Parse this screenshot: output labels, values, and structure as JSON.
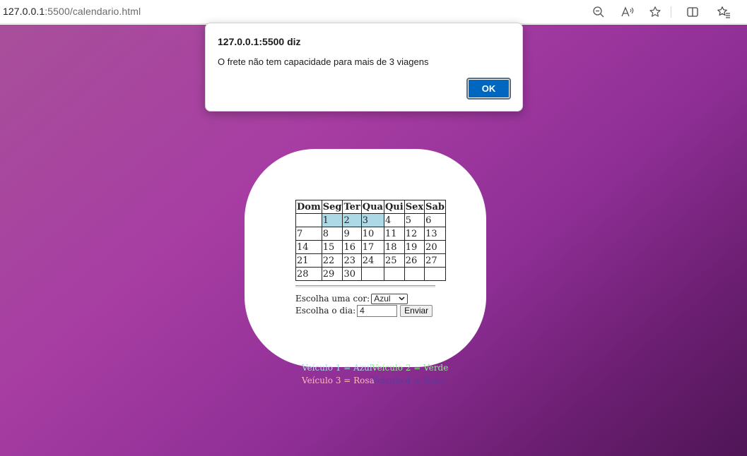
{
  "browser": {
    "url_host": "127.0.0.1",
    "url_rest": ":5500/calendario.html"
  },
  "dialog": {
    "title": "127.0.0.1:5500 diz",
    "message": "O frete não tem capacidade para mais de 3 viagens",
    "ok_label": "OK"
  },
  "calendar": {
    "headers": [
      "Dom",
      "Seg",
      "Ter",
      "Qua",
      "Qui",
      "Sex",
      "Sab"
    ],
    "rows": [
      [
        "",
        "1",
        "2",
        "3",
        "4",
        "5",
        "6"
      ],
      [
        "7",
        "8",
        "9",
        "10",
        "11",
        "12",
        "13"
      ],
      [
        "14",
        "15",
        "16",
        "17",
        "18",
        "19",
        "20"
      ],
      [
        "21",
        "22",
        "23",
        "24",
        "25",
        "26",
        "27"
      ],
      [
        "28",
        "29",
        "30",
        "",
        "",
        "",
        ""
      ]
    ],
    "highlighted_days": [
      "1",
      "2",
      "3"
    ],
    "highlight_color": "#add8e6"
  },
  "form": {
    "color_label": "Escolha uma cor:",
    "color_selected": "Azul",
    "day_label": "Escolha o dia:",
    "day_value": "4",
    "submit_label": "Enviar"
  },
  "legend": {
    "v1": "Veículo 1 = Azul",
    "v2": "Veículo 2 = Verde",
    "v3": "Veículo 3 = Rosa",
    "v4": "Veículo 4 = Roxo"
  },
  "colors": {
    "azul": "#add8e6",
    "verde": "#90ee90",
    "rosa": "#ffb6c1",
    "roxo": "#5b3a9a",
    "ok_button": "#0067c0"
  }
}
